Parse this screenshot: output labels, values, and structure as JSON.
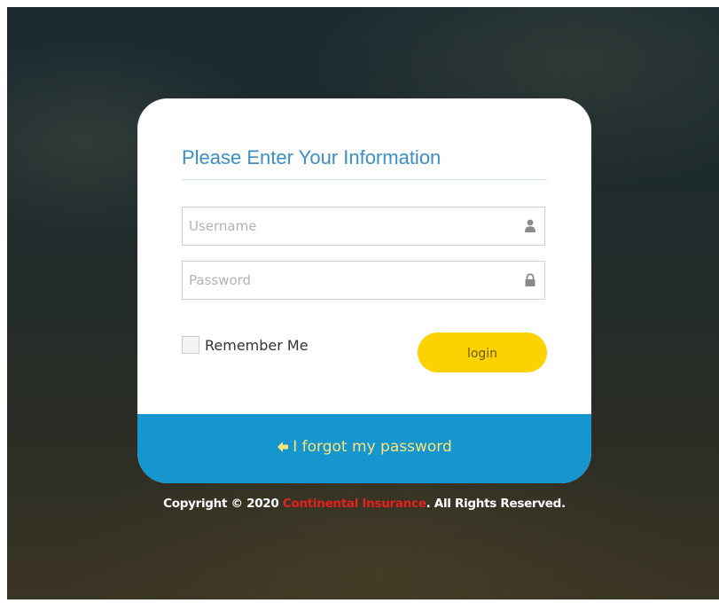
{
  "login_form": {
    "title": "Please Enter Your Information",
    "username": {
      "placeholder": "Username",
      "value": "",
      "icon": "user-icon"
    },
    "password": {
      "placeholder": "Password",
      "value": "",
      "icon": "lock-icon"
    },
    "remember_me": {
      "label": "Remember Me",
      "checked": false
    },
    "login_button_label": "login"
  },
  "forgot_password": {
    "label": "I forgot my password",
    "icon": "arrow-left-icon"
  },
  "footer": {
    "copyright_prefix": "Copyright © 2020 ",
    "company_name": "Continental Insurance",
    "copyright_suffix": ". All Rights Reserved."
  },
  "colors": {
    "title": "#3b8fc6",
    "login_button": "#fcd200",
    "forgot_bar": "#1596cf",
    "company_name": "#e4211b"
  }
}
